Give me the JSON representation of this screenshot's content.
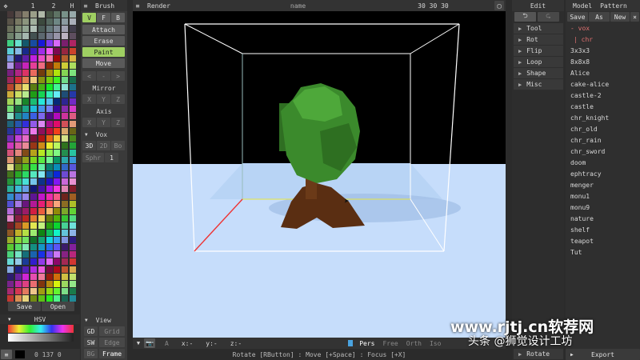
{
  "palette_toolbar": {
    "move_icon": "move-icon",
    "labels": [
      "1",
      "2",
      "H"
    ]
  },
  "brush_panel": {
    "title": "Brush",
    "modes": [
      "V",
      "F",
      "B"
    ],
    "actions": [
      "Attach",
      "Erase",
      "Paint",
      "Move"
    ],
    "active_action": "Paint",
    "arrows": [
      "<",
      "-",
      ">"
    ],
    "mirror_label": "Mirror",
    "mirror_axes": [
      "X",
      "Y",
      "Z"
    ],
    "axis_label": "Axis",
    "axis_axes": [
      "X",
      "Y",
      "Z"
    ],
    "vox_label": "Vox",
    "vox_modes": [
      "3D",
      "2D",
      "Bo"
    ],
    "sphr_label": "Sphr",
    "sphr_value": "1",
    "view_label": "View",
    "view_rows": [
      [
        "GD",
        "Grid"
      ],
      [
        "SW",
        "Edge"
      ],
      [
        "BG",
        "Frame"
      ]
    ]
  },
  "palette_actions": {
    "save": "Save",
    "open": "Open"
  },
  "hsv": {
    "label": "HSV",
    "values": "0 137 0"
  },
  "top_bar": {
    "render": "Render",
    "name": "name",
    "size": "30 30 30"
  },
  "viewport_bottom": {
    "x_label": "x:-",
    "y_label": "y:-",
    "z_label": "z:-",
    "a_label": "A",
    "modes": [
      "Pers",
      "Free",
      "Orth",
      "Iso"
    ],
    "active_mode": "Pers",
    "status": "Rotate [RButton] : Move [+Space] : Focus [+X]"
  },
  "edit_panel": {
    "title": "Edit",
    "menu": [
      "Tool",
      "Rot",
      "Flip",
      "Loop",
      "Shape",
      "Misc"
    ],
    "bottom": "Rotate"
  },
  "file_panel": {
    "tabs": [
      "Model",
      "Pattern"
    ],
    "actions": [
      "Save",
      "As",
      "New"
    ],
    "tree": [
      "- vox",
      "| chr"
    ],
    "files": [
      "3x3x3",
      "8x8x8",
      "Alice",
      "cake-alice",
      "castle-2",
      "castle",
      "chr_knight",
      "chr_old",
      "chr_rain",
      "chr_sword",
      "doom",
      "ephtracy",
      "menger",
      "monu1",
      "monu9",
      "nature",
      "shelf",
      "teapot",
      "Tut"
    ],
    "export": "Export"
  },
  "watermark": {
    "line1": "www.rjtj.cn软荐网",
    "line2": "头条 @狮觉设计工坊"
  },
  "colors": {
    "accent": "#9fcf62",
    "bg": "#2b2b2b",
    "panel": "#3a3a3a",
    "sky": "#c6ddfb"
  }
}
